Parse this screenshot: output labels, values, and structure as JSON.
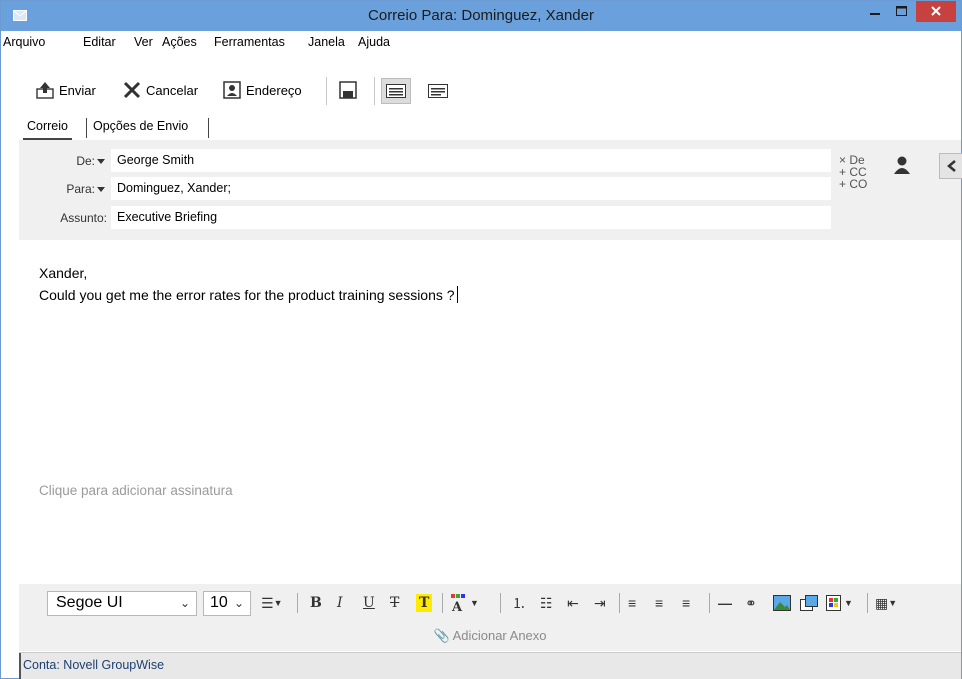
{
  "window": {
    "title": "Correio Para: Dominguez, Xander",
    "minimize_label": "‒",
    "maximize_label": "▫",
    "close_label": "✕",
    "accent_color": "#6aa1dd",
    "close_color": "#c7413e"
  },
  "menu": [
    "Arquivo",
    "Editar",
    "Ver",
    "Ações",
    "Ferramentas",
    "Janela",
    "Ajuda"
  ],
  "toolbar": {
    "send_label": "Enviar",
    "cancel_label": "Cancelar",
    "address_label": "Endereço"
  },
  "tabs": [
    "Correio",
    "Opções de Envio"
  ],
  "header": {
    "from_label": "De:",
    "from_value": "George Smith",
    "to_label": "Para:",
    "to_value": "Dominguez, Xander;",
    "subject_label": "Assunto:",
    "subject_value": "Executive Briefing",
    "side_links": [
      "× De",
      "+ CC",
      "+ CO"
    ]
  },
  "body": {
    "line1": "Xander,",
    "line2": "Could you get me the error rates for the product training sessions ?",
    "signature_hint": "Clique para adicionar assinatura"
  },
  "format": {
    "font": "Segoe UI",
    "size": "10",
    "bold_label": "B",
    "italic_label": "I",
    "underline_label": "U",
    "strike_label": "T",
    "highlight_label": "T"
  },
  "attach_label": "Adicionar Anexo",
  "status": "Conta: Novell GroupWise"
}
